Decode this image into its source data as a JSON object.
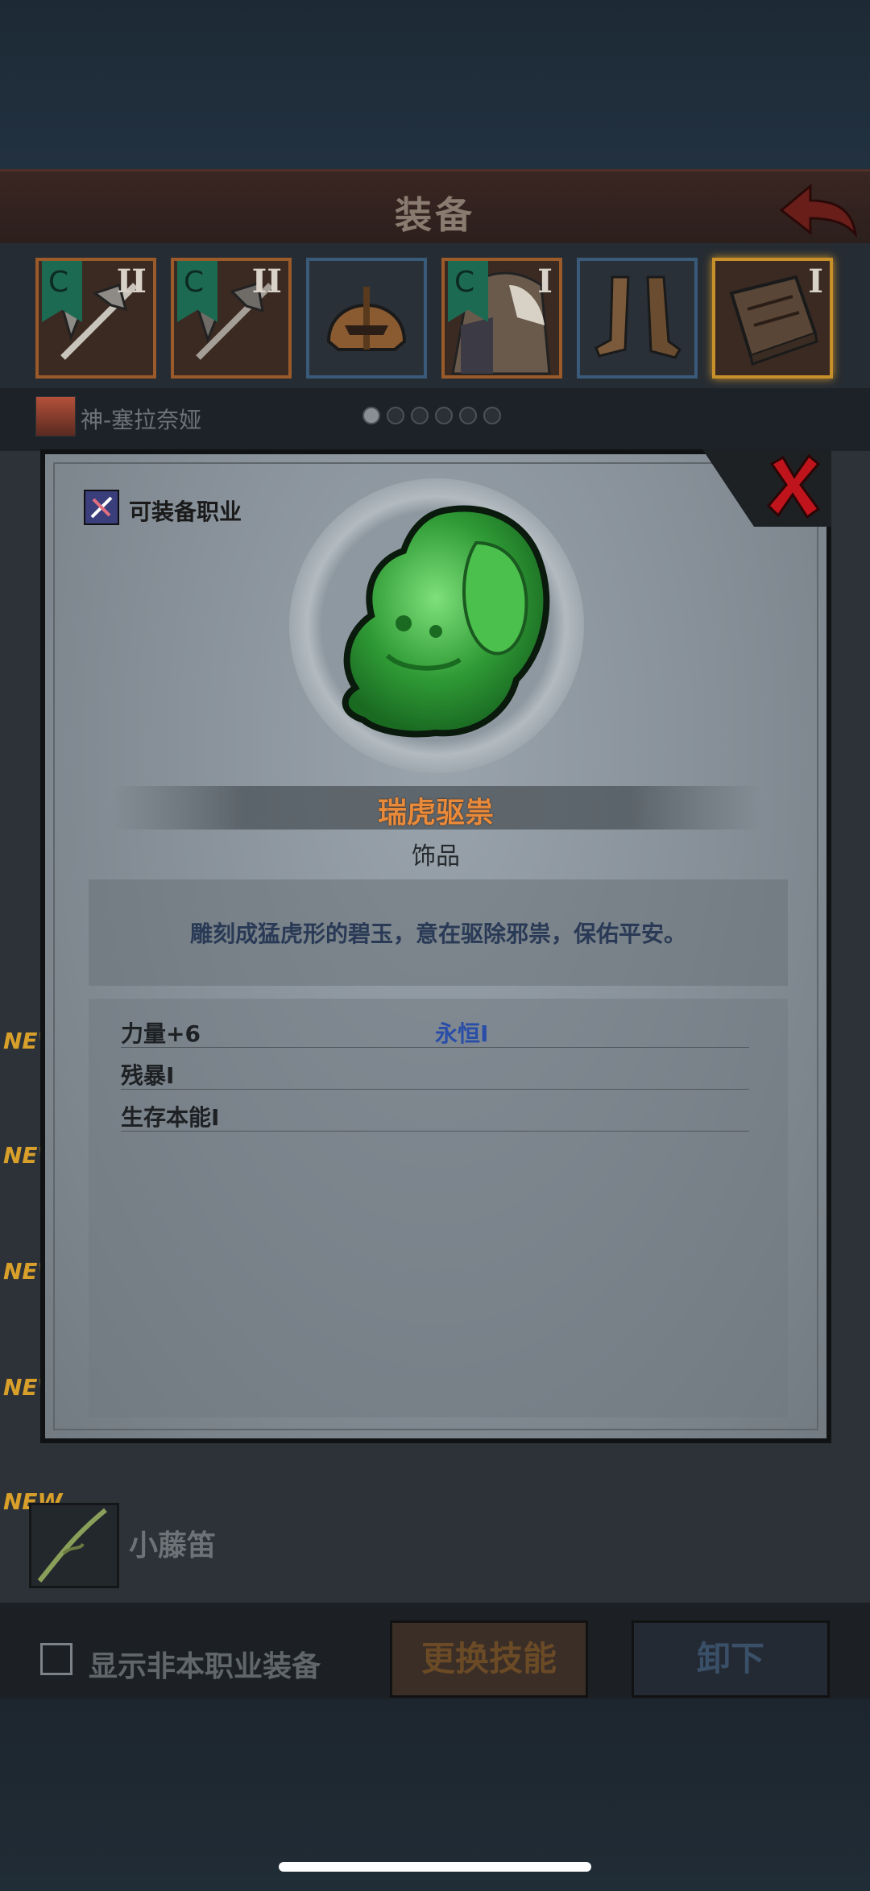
{
  "header": {
    "title": "装备"
  },
  "slots": [
    {
      "tier": "II",
      "flag": "C"
    },
    {
      "tier": "II",
      "flag": "C"
    },
    {
      "tier": ""
    },
    {
      "tier": "I",
      "flag": "C"
    },
    {
      "tier": ""
    },
    {
      "tier": "I"
    }
  ],
  "character": {
    "name": "神-塞拉奈娅"
  },
  "pager": {
    "total": 6,
    "current": 1
  },
  "list": {
    "new_label": "NEW",
    "last_item_name": "小藤笛"
  },
  "bottom": {
    "show_other_classes_label": "显示非本职业装备",
    "change_skill_label": "更换技能",
    "unequip_label": "卸下"
  },
  "modal": {
    "job_label": "可装备职业",
    "item_name": "瑞虎驱祟",
    "item_type": "饰品",
    "description": "雕刻成猛虎形的碧玉，意在驱除邪祟，保佑平安。",
    "stats": [
      "力量+6",
      "残暴I",
      "生存本能I"
    ],
    "bonus_stat": "永恒I"
  },
  "colors": {
    "item_name": "#e88a3a",
    "bonus_stat": "#2a4ea8",
    "close_icon": "#c0141c",
    "jade": "#2f9a35"
  }
}
